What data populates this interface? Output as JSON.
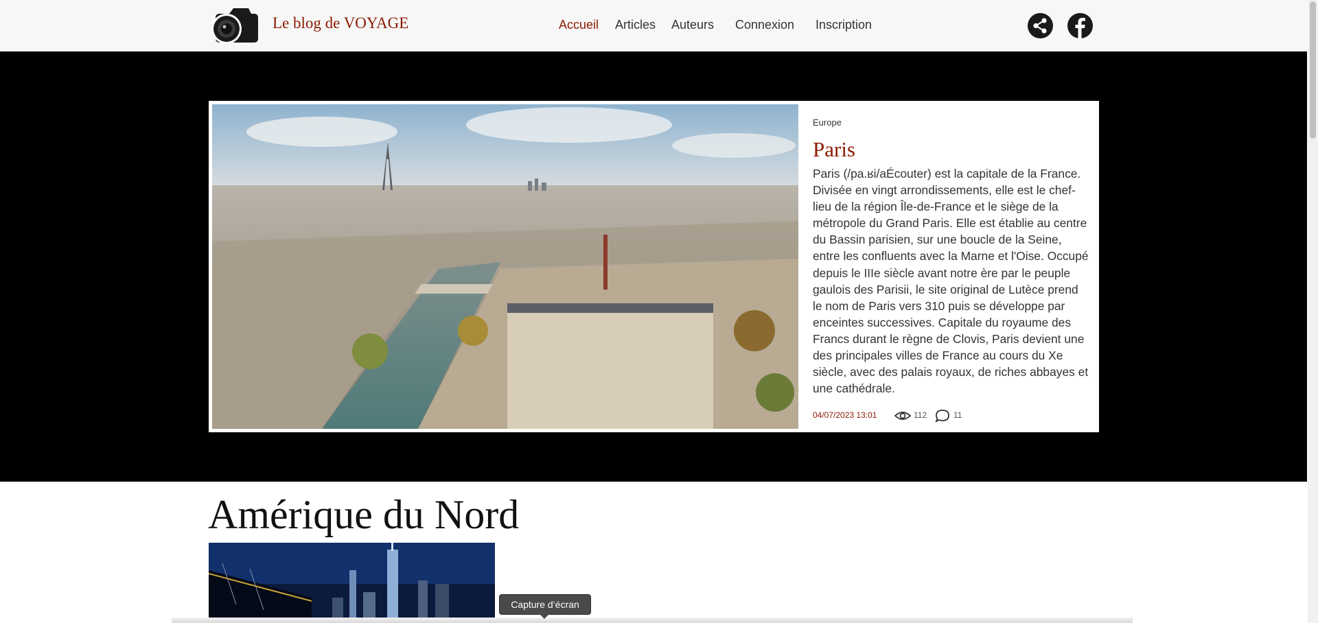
{
  "header": {
    "brand": "Le blog de VOYAGE",
    "nav": [
      "Accueil",
      "Articles",
      "Auteurs",
      "Connexion",
      "Inscription"
    ],
    "active_nav": "Accueil",
    "social_icons": [
      "share-icon",
      "facebook-icon"
    ]
  },
  "featured": {
    "category": "Europe",
    "title": "Paris",
    "excerpt": "Paris (/pa.ʁi/aÉcouter) est la capitale de la France. Divisée en vingt arrondissements, elle est le chef-lieu de la région Île-de-France et le siège de la métropole du Grand Paris. Elle est établie au centre du Bassin parisien, sur une boucle de la Seine, entre les confluents avec la Marne et l'Oise. Occupé depuis le IIIe siècle avant notre ère par le peuple gaulois des Parisii, le site original de Lutèce prend le nom de Paris vers 310 puis se développe par enceintes successives. Capitale du royaume des Francs durant le règne de Clovis, Paris devient une des principales villes de France au cours du Xe siècle, avec des palais royaux, de riches abbayes et une cathédrale.",
    "date": "04/07/2023 13:01",
    "views": "112",
    "comments": "11"
  },
  "section": {
    "title": "Amérique du Nord"
  },
  "tooltip": {
    "text": "Capture d’écran"
  },
  "colors": {
    "accent": "#8b1a00",
    "hero_background": "#000000",
    "header_background": "#f7f7f7"
  }
}
